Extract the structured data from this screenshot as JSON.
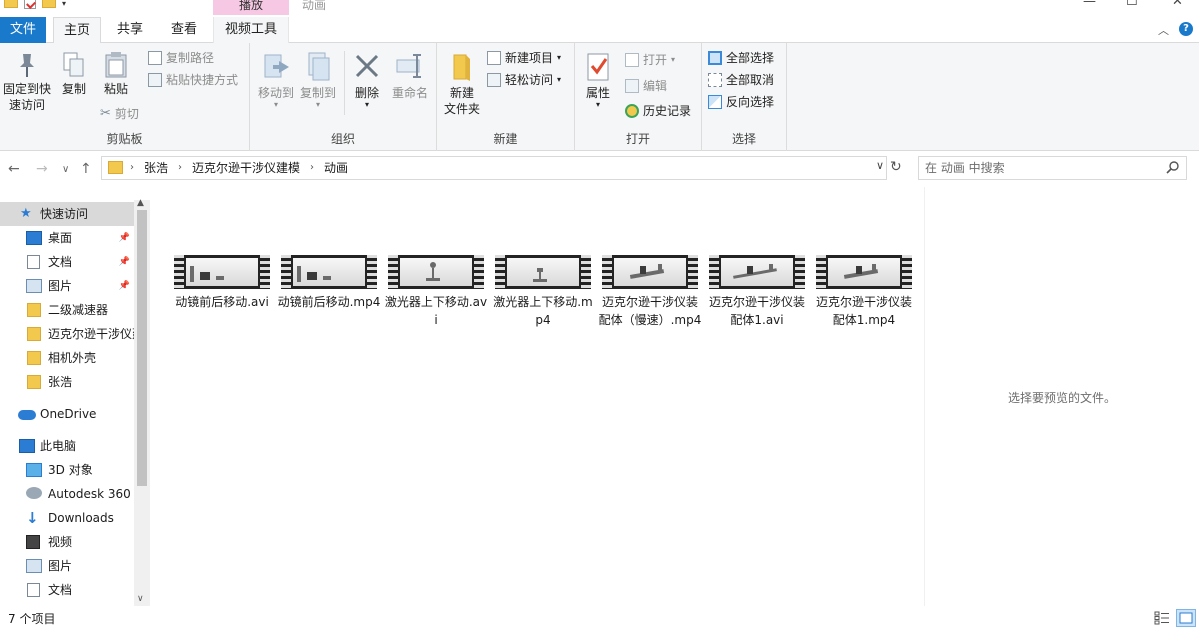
{
  "window": {
    "title": "动画",
    "context_tab_header": "播放"
  },
  "ribbon_tabs": [
    "文件",
    "主页",
    "共享",
    "查看",
    "视频工具"
  ],
  "ribbon": {
    "clipboard": {
      "label": "剪贴板",
      "pin": "固定到快速访问",
      "pin_line1": "固定到快",
      "pin_line2": "速访问",
      "copy": "复制",
      "paste": "粘贴",
      "copy_path": "复制路径",
      "paste_shortcut": "粘贴快捷方式",
      "cut": "剪切"
    },
    "organize": {
      "label": "组织",
      "move_to": "移动到",
      "copy_to": "复制到",
      "delete": "删除",
      "rename": "重命名"
    },
    "new": {
      "label": "新建",
      "new_folder_line1": "新建",
      "new_folder_line2": "文件夹",
      "new_item": "新建项目",
      "easy_access": "轻松访问"
    },
    "open": {
      "label": "打开",
      "properties": "属性",
      "open": "打开",
      "edit": "编辑",
      "history": "历史记录"
    },
    "select": {
      "label": "选择",
      "select_all": "全部选择",
      "select_none": "全部取消",
      "invert": "反向选择"
    }
  },
  "address": {
    "crumbs": [
      "张浩",
      "迈克尔逊干涉仪建模",
      "动画"
    ]
  },
  "search": {
    "placeholder": "在 动画 中搜索"
  },
  "nav": {
    "quick_access": "快速访问",
    "items": [
      {
        "label": "桌面",
        "pinned": true
      },
      {
        "label": "文档",
        "pinned": true
      },
      {
        "label": "图片",
        "pinned": true
      },
      {
        "label": "二级减速器"
      },
      {
        "label": "迈克尔逊干涉仪建模"
      },
      {
        "label": "相机外壳"
      },
      {
        "label": "张浩"
      }
    ],
    "onedrive": "OneDrive",
    "this_pc": "此电脑",
    "pc_items": [
      "3D 对象",
      "Autodesk 360",
      "Downloads",
      "视频",
      "图片",
      "文档"
    ]
  },
  "files": [
    {
      "name": "动镜前后移动.avi"
    },
    {
      "name": "动镜前后移动.mp4"
    },
    {
      "name": "激光器上下移动.avi"
    },
    {
      "name": "激光器上下移动.mp4"
    },
    {
      "name": "迈克尔逊干涉仪装配体（慢速）.mp4"
    },
    {
      "name": "迈克尔逊干涉仪装配体1.avi"
    },
    {
      "name": "迈克尔逊干涉仪装配体1.mp4"
    }
  ],
  "preview": {
    "message": "选择要预览的文件。"
  },
  "status": {
    "count": "7 个项目"
  },
  "colors": {
    "accent": "#1979ca",
    "context_tab": "#f6c8e4",
    "selected": "#d9d9d9",
    "folder": "#f2c94c"
  }
}
